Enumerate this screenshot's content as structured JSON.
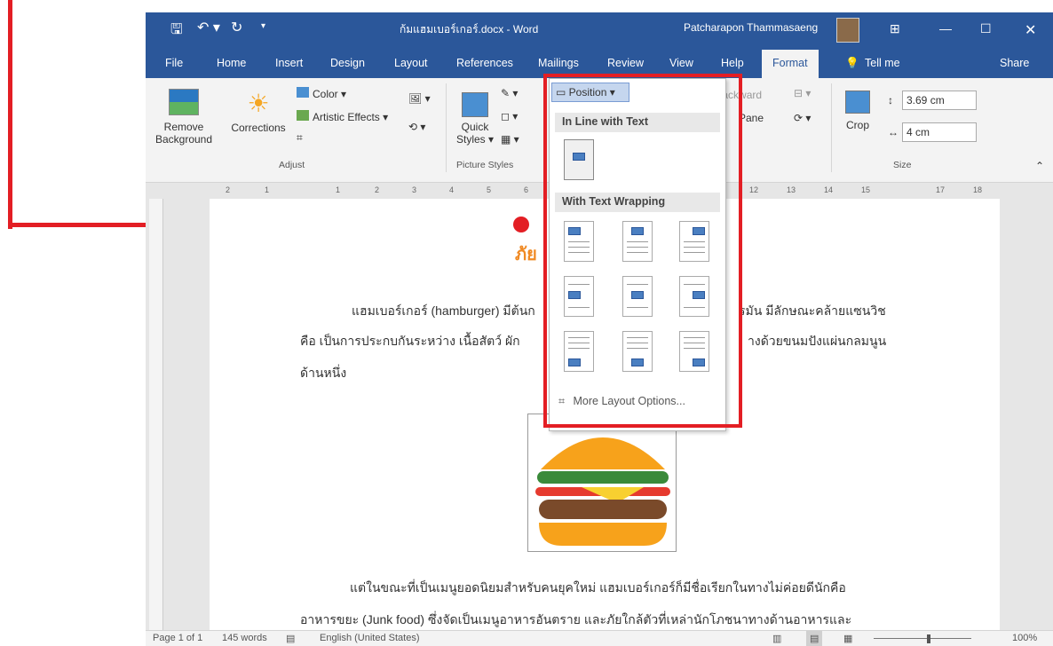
{
  "window": {
    "title": "ก้มแฮมเบอร์เกอร์.docx  -  Word",
    "user": "Patcharapon Thammasaeng"
  },
  "tabs": [
    "File",
    "Home",
    "Insert",
    "Design",
    "Layout",
    "References",
    "Mailings",
    "Review",
    "View",
    "Help",
    "Format"
  ],
  "tell_me": "Tell me",
  "share": "Share",
  "ribbon": {
    "remove_background": [
      "Remove",
      "Background"
    ],
    "corrections": "Corrections",
    "color": "Color ▾",
    "artistic_effects": "Artistic Effects ▾",
    "adjust": "Adjust",
    "quick_styles": [
      "Quick",
      "Styles ▾"
    ],
    "picture_styles": "Picture Styles",
    "position": "Position ▾",
    "send_backward": "Send Backward",
    "pane": "Pane",
    "crop": "Crop",
    "height": "3.69 cm",
    "width": "4 cm",
    "size": "Size"
  },
  "dropdown": {
    "inline_header": "In Line with Text",
    "wrapping_header": "With Text Wrapping",
    "more": "More Layout Options..."
  },
  "document": {
    "title": "ภัย",
    "p1_line1a": "แฮมเบอร์เกอร์ (hamburger) มีต้นก",
    "p1_line1b": "รมัน มีลักษณะคล้ายแซนวิช",
    "p1_line2a": "คือ เป็นการประกบกันระหว่าง เนื้อสัตว์ ผัก",
    "p1_line2b": "างด้วยขนมปังแผ่นกลมนูน",
    "p1_line3": "ด้านหนึ่ง",
    "p2_line1": "แต่ในขณะที่เป็นเมนูยอดนิยมสำหรับคนยุคใหม่  แฮมเบอร์เกอร์ก็มีชื่อเรียกในทางไม่ค่อยดีนักคือ",
    "p2_line2": "อาหารขยะ (Junk food) ซึ่งจัดเป็นเมนูอาหารอันตราย และภัยใกล้ตัวที่เหล่านักโภชนาทางด้านอาหารและ"
  },
  "ruler": [
    "2",
    "1",
    "1",
    "2",
    "3",
    "4",
    "5",
    "6",
    "12",
    "13",
    "14",
    "15",
    "17",
    "18"
  ],
  "status": {
    "page": "Page 1 of 1",
    "words": "145 words",
    "language": "English (United States)",
    "zoom": "100%"
  },
  "colors": {
    "word_blue": "#2b579a",
    "highlight_red": "#e31e24"
  }
}
